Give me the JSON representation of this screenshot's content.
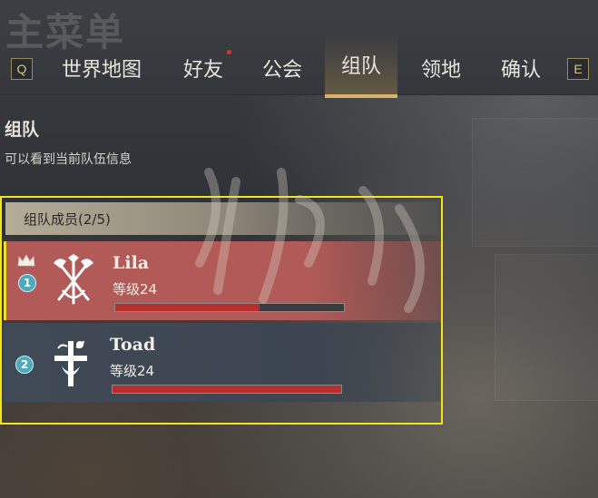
{
  "header": {
    "main_title": "主菜单",
    "key_left": "Q",
    "key_right": "E",
    "tabs": [
      {
        "label": "世界地图",
        "active": false,
        "notify": false
      },
      {
        "label": "好友",
        "active": false,
        "notify": true
      },
      {
        "label": "公会",
        "active": false,
        "notify": false
      },
      {
        "label": "组队",
        "active": true,
        "notify": false
      },
      {
        "label": "领地",
        "active": false,
        "notify": false
      },
      {
        "label": "确认",
        "active": false,
        "notify": false
      }
    ]
  },
  "section": {
    "title": "组队",
    "subtitle": "可以看到当前队伍信息"
  },
  "party": {
    "header": "组队成员(2/5)",
    "members": [
      {
        "slot": "1",
        "name": "Lila",
        "level": "等级24",
        "leader": true,
        "hp_fraction": 0.63,
        "emblem": "crossed-axes-emblem-icon"
      },
      {
        "slot": "2",
        "name": "Toad",
        "level": "等级24",
        "leader": false,
        "hp_fraction": 1.0,
        "emblem": "cross-sword-emblem-icon"
      }
    ]
  },
  "colors": {
    "accent_gold": "#d9b36a",
    "highlight_yellow": "#f3e51c",
    "leader_row": "#b15a57",
    "member_row": "#404a56",
    "hp_bar": "#b82e2e",
    "notify_dot": "#e0322b"
  }
}
